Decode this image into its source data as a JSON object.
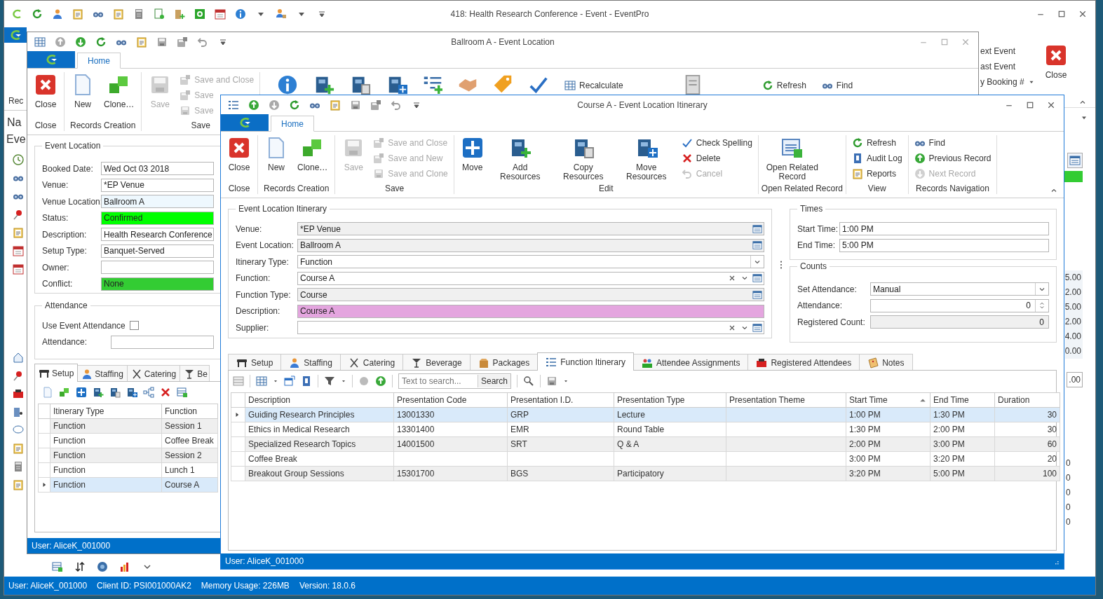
{
  "app": {
    "title": "418: Health Research Conference - Event - EventPro",
    "nav": [
      "Rec",
      "Na",
      "Eve"
    ],
    "ribbon_right": [
      {
        "label": "ext Event",
        "kind": "button"
      },
      {
        "label": "ast Event",
        "kind": "button"
      },
      {
        "label": "y Booking #",
        "kind": "menu"
      }
    ],
    "close_label": "Close",
    "side_values": [
      "5.00",
      "2.00",
      "5.00",
      "2.00",
      "4.00",
      "0.00"
    ],
    "side_total": ".00",
    "side_counts": [
      "0",
      "0",
      "0",
      "0",
      "0"
    ],
    "status_bar": [
      "User: AliceK_001000",
      "Client ID: PSI001000AK2",
      "Memory Usage: 226MB",
      "Version: 18.0.6"
    ]
  },
  "location_window": {
    "title": "Ballroom A - Event Location",
    "tab": "Home",
    "ribbon_groups": [
      {
        "label": "Close",
        "large": [
          {
            "label": "Close",
            "disabled": false
          }
        ]
      },
      {
        "label": "Records Creation",
        "large": [
          {
            "label": "New",
            "disabled": false
          },
          {
            "label": "Clone…",
            "disabled": false
          }
        ]
      },
      {
        "label": "Save",
        "large": [
          {
            "label": "Save",
            "disabled": true
          }
        ],
        "small": [
          {
            "label": "Save and Close",
            "disabled": true
          },
          {
            "label": "Save",
            "disabled": true
          },
          {
            "label": "Save",
            "disabled": true
          }
        ]
      }
    ],
    "ribbon_more": [
      "Recalculate",
      "Refresh",
      "Find"
    ],
    "event_location": {
      "title": "Event Location",
      "fields": [
        {
          "label": "Booked Date:",
          "value": "Wed Oct 03 2018"
        },
        {
          "label": "Venue:",
          "value": "*EP Venue"
        },
        {
          "label": "Venue Location:",
          "value": "Ballroom A",
          "color": "#eef8fe"
        },
        {
          "label": "Status:",
          "value": "Confirmed",
          "color": "#00ff00"
        },
        {
          "label": "Description:",
          "value": "Health Research Conference"
        },
        {
          "label": "Setup Type:",
          "value": "Banquet-Served"
        },
        {
          "label": "Owner:"
        },
        {
          "label": "Conflict:",
          "value": "None",
          "color": "#33cc33"
        }
      ]
    },
    "attendance": {
      "title": "Attendance",
      "use_label": "Use Event Attendance",
      "use_checked": false,
      "attendance_label": "Attendance:"
    },
    "tabs": [
      {
        "label": "Setup",
        "selected": true
      },
      {
        "label": "Staffing",
        "selected": false
      },
      {
        "label": "Catering",
        "selected": false
      },
      {
        "label": "Be",
        "selected": false
      }
    ],
    "grid": {
      "columns": [
        "Itinerary Type",
        "Function"
      ],
      "rows": [
        {
          "itinerary_type": "Function",
          "function": "Session 1",
          "selected": false
        },
        {
          "itinerary_type": "Function",
          "function": "Coffee Break",
          "selected": false
        },
        {
          "itinerary_type": "Function",
          "function": "Session 2",
          "selected": false
        },
        {
          "itinerary_type": "Function",
          "function": "Lunch 1",
          "selected": false
        },
        {
          "itinerary_type": "Function",
          "function": "Course A",
          "selected": true
        }
      ]
    },
    "status": "User: AliceK_001000"
  },
  "itinerary_window": {
    "title": "Course A - Event Location Itinerary",
    "tab": "Home",
    "ribbon_groups": [
      {
        "label": "Close",
        "large": [
          {
            "label": "Close",
            "disabled": false
          }
        ]
      },
      {
        "label": "Records Creation",
        "large": [
          {
            "label": "New",
            "disabled": false
          },
          {
            "label": "Clone…",
            "disabled": false
          }
        ]
      },
      {
        "label": "Save",
        "large": [
          {
            "label": "Save",
            "disabled": true
          }
        ],
        "small": [
          {
            "label": "Save and Close",
            "disabled": true
          },
          {
            "label": "Save and New",
            "disabled": true
          },
          {
            "label": "Save and Clone",
            "disabled": true
          }
        ]
      },
      {
        "label": "Edit",
        "large": [
          {
            "label": "Move",
            "disabled": false
          },
          {
            "label": "Add Resources",
            "disabled": false
          },
          {
            "label": "Copy Resources",
            "disabled": false
          },
          {
            "label": "Move Resources",
            "disabled": false
          }
        ],
        "small": [
          {
            "label": "Check Spelling",
            "disabled": false
          },
          {
            "label": "Delete",
            "disabled": false
          },
          {
            "label": "Cancel",
            "disabled": true
          }
        ]
      },
      {
        "label": "Open Related Record",
        "large": [
          {
            "label": "Open Related Record",
            "disabled": false
          }
        ]
      },
      {
        "label": "View",
        "small": [
          {
            "label": "Refresh",
            "disabled": false
          },
          {
            "label": "Audit Log",
            "disabled": false
          },
          {
            "label": "Reports",
            "disabled": false
          }
        ]
      },
      {
        "label": "Records Navigation",
        "small": [
          {
            "label": "Find",
            "disabled": false
          },
          {
            "label": "Previous Record",
            "disabled": false
          },
          {
            "label": "Next Record",
            "disabled": true
          }
        ]
      }
    ],
    "itinerary": {
      "title": "Event Location Itinerary",
      "fields": [
        {
          "label": "Venue:",
          "value": "*EP Venue",
          "kind": "lookup",
          "readonly": true
        },
        {
          "label": "Event Location:",
          "value": "Ballroom A",
          "kind": "lookup",
          "readonly": true
        },
        {
          "label": "Itinerary Type:",
          "value": "Function",
          "kind": "dropdown",
          "readonly": false
        },
        {
          "label": "Function:",
          "value": "Course A",
          "kind": "combo",
          "readonly": false
        },
        {
          "label": "Function Type:",
          "value": "Course",
          "kind": "lookup",
          "readonly": true
        },
        {
          "label": "Description:",
          "value": "Course A",
          "kind": "text",
          "color": "#e4a5df"
        },
        {
          "label": "Supplier:",
          "kind": "combo",
          "readonly": false
        }
      ]
    },
    "times": {
      "title": "Times",
      "fields": [
        {
          "label": "Start Time:",
          "value": "1:00 PM",
          "kind": "text",
          "readonly": false
        },
        {
          "label": "End Time:",
          "value": "5:00 PM",
          "kind": "text",
          "readonly": false
        }
      ]
    },
    "counts": {
      "title": "Counts",
      "fields": [
        {
          "label": "Set Attendance:",
          "value": "Manual",
          "kind": "dropdown",
          "readonly": false
        },
        {
          "label": "Attendance:",
          "value": "0",
          "kind": "spin",
          "readonly": false
        },
        {
          "label": "Registered Count:",
          "value": "0",
          "kind": "number",
          "readonly": true
        }
      ]
    },
    "tabs": [
      {
        "label": "Setup",
        "selected": false
      },
      {
        "label": "Staffing",
        "selected": false
      },
      {
        "label": "Catering",
        "selected": false
      },
      {
        "label": "Beverage",
        "selected": false
      },
      {
        "label": "Packages",
        "selected": false
      },
      {
        "label": "Function Itinerary",
        "selected": true
      },
      {
        "label": "Attendee Assignments",
        "selected": false
      },
      {
        "label": "Registered Attendees",
        "selected": false
      },
      {
        "label": "Notes",
        "selected": false
      }
    ],
    "search": {
      "placeholder": "Text to search...",
      "button": "Search"
    },
    "grid": {
      "columns": [
        {
          "label": "Description",
          "sorted": false
        },
        {
          "label": "Presentation Code",
          "sorted": false
        },
        {
          "label": "Presentation I.D.",
          "sorted": false
        },
        {
          "label": "Presentation Type",
          "sorted": false
        },
        {
          "label": "Presentation Theme",
          "sorted": false
        },
        {
          "label": "Start Time",
          "sorted": true
        },
        {
          "label": "End Time",
          "sorted": false
        },
        {
          "label": "Duration",
          "sorted": false
        }
      ],
      "rows": [
        {
          "description": "Guiding Research Principles",
          "presentation_code": "13001330",
          "presentation_id": "GRP",
          "presentation_type": "Lecture",
          "start_time": "1:00 PM",
          "end_time": "1:30 PM",
          "duration": "30",
          "selected": true
        },
        {
          "description": "Ethics in Medical Research",
          "presentation_code": "13301400",
          "presentation_id": "EMR",
          "presentation_type": "Round Table",
          "start_time": "1:30 PM",
          "end_time": "2:00 PM",
          "duration": "30",
          "selected": false
        },
        {
          "description": "Specialized Research Topics",
          "presentation_code": "14001500",
          "presentation_id": "SRT",
          "presentation_type": "Q & A",
          "start_time": "2:00 PM",
          "end_time": "3:00 PM",
          "duration": "60",
          "selected": false
        },
        {
          "description": "Coffee Break",
          "start_time": "3:00 PM",
          "end_time": "3:20 PM",
          "duration": "20",
          "selected": false
        },
        {
          "description": "Breakout Group Sessions",
          "presentation_code": "15301700",
          "presentation_id": "BGS",
          "presentation_type": "Participatory",
          "start_time": "3:20 PM",
          "end_time": "5:00 PM",
          "duration": "100",
          "selected": false
        }
      ]
    },
    "status": "User: AliceK_001000"
  }
}
